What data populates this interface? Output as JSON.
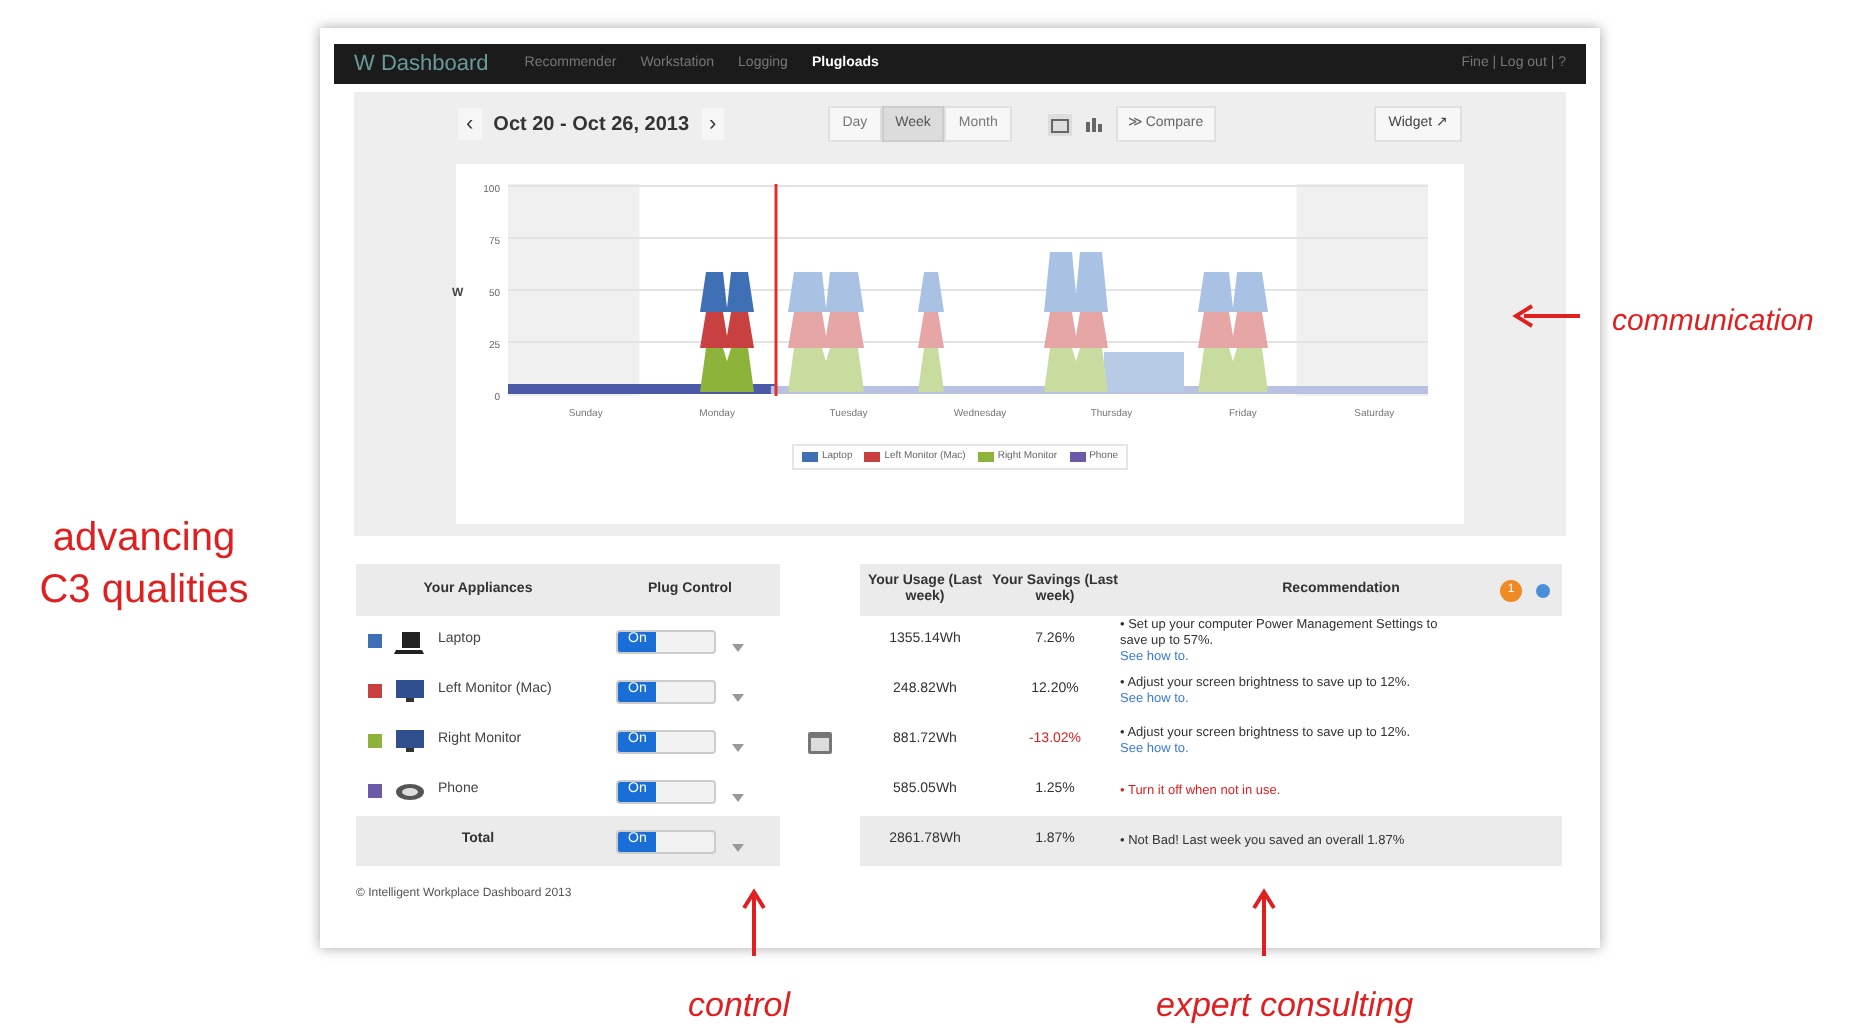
{
  "annotations": {
    "left": "advancing C3 qualities",
    "right": "communication",
    "bottom_control": "control",
    "bottom_expert": "expert consulting"
  },
  "nav": {
    "brand": "W Dashboard",
    "items": [
      {
        "label": "Recommender",
        "selected": false
      },
      {
        "label": "Workstation",
        "selected": false
      },
      {
        "label": "Logging",
        "selected": false
      },
      {
        "label": "Plugloads",
        "selected": true
      }
    ],
    "user": "Fine | Log out | ?"
  },
  "toolbar": {
    "prev": "‹",
    "range": "Oct 20 - Oct 26, 2013",
    "next": "›",
    "periods": [
      {
        "label": "Day",
        "selected": false
      },
      {
        "label": "Week",
        "selected": true
      },
      {
        "label": "Month",
        "selected": false
      }
    ],
    "compare": "≫ Compare",
    "widget": "Widget ↗"
  },
  "chart": {
    "ylabel": "W",
    "yticks": [
      "100",
      "75",
      "50",
      "25",
      "0"
    ],
    "days": [
      "Sunday",
      "Monday",
      "Tuesday",
      "Wednesday",
      "Thursday",
      "Friday",
      "Saturday"
    ],
    "legend": [
      {
        "label": "Laptop",
        "color": "#3f6fb5"
      },
      {
        "label": "Left Monitor (Mac)",
        "color": "#c94040"
      },
      {
        "label": "Right Monitor",
        "color": "#8db33a"
      },
      {
        "label": "Phone",
        "color": "#6a5aa8"
      }
    ]
  },
  "table": {
    "columns": [
      "Your Appliances",
      "Plug Control",
      "Your Usage (Last week)",
      "Your Savings (Last week)",
      "Recommendation"
    ],
    "badge": "1",
    "rows": [
      {
        "kind": "laptop",
        "color": "#3f6fb5",
        "name": "Laptop",
        "toggle": "On",
        "on": true,
        "usage": "1355.14Wh",
        "savings": "7.26%",
        "savings_negative": false,
        "recommendation": "• Set up your computer Power Management Settings to save up to 57%.",
        "link": "See how to.",
        "alert": false
      },
      {
        "kind": "monitor",
        "color": "#c94040",
        "name": "Left Monitor (Mac)",
        "toggle": "On",
        "on": true,
        "usage": "248.82Wh",
        "savings": "12.20%",
        "savings_negative": false,
        "recommendation": "• Adjust your screen brightness to save up to 12%.",
        "link": "See how to.",
        "alert": false
      },
      {
        "kind": "monitor",
        "color": "#8db33a",
        "name": "Right Monitor",
        "toggle": "On",
        "on": true,
        "usage": "881.72Wh",
        "savings": "-13.02%",
        "savings_negative": true,
        "recommendation": "• Adjust your screen brightness to save up to 12%.",
        "link": "See how to.",
        "alert": false
      },
      {
        "kind": "phone",
        "color": "#6a5aa8",
        "name": "Phone",
        "toggle": "On",
        "on": true,
        "usage": "585.05Wh",
        "savings": "1.25%",
        "savings_negative": false,
        "recommendation": "• Turn it off when not in use.",
        "alert": true
      }
    ],
    "total": {
      "name": "Total",
      "toggle": "On",
      "on": true,
      "usage": "2861.78Wh",
      "savings": "1.87%",
      "recommendation": "• Not Bad! Last week you saved an overall 1.87%"
    }
  },
  "footer": "© Intelligent Workplace Dashboard 2013"
}
